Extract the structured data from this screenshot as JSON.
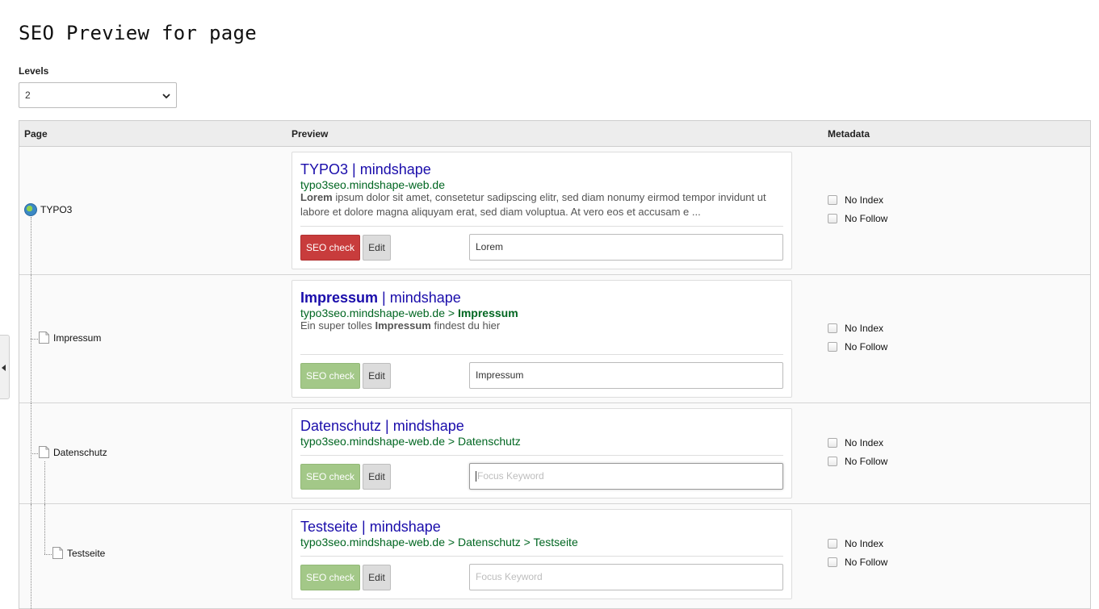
{
  "title": "SEO Preview for page",
  "levels": {
    "label": "Levels",
    "value": "2"
  },
  "table": {
    "headers": {
      "page": "Page",
      "preview": "Preview",
      "metadata": "Metadata"
    }
  },
  "buttons": {
    "seo_check": "SEO check",
    "edit": "Edit"
  },
  "metadata_labels": {
    "no_index": "No Index",
    "no_follow": "No Follow"
  },
  "keyword_placeholder": "Focus Keyword",
  "colors": {
    "seo_bad": "#c83c3c",
    "seo_good": "#a3c888",
    "serp_title": "#1a0dab",
    "serp_url": "#006621"
  },
  "rows": [
    {
      "page": "TYPO3",
      "icon": "globe-icon",
      "serp_title": "TYPO3 | mindshape",
      "serp_url": "typo3seo.mindshape-web.de",
      "desc_bold": "Lorem",
      "desc_rest": " ipsum dolor sit amet, consetetur sadipscing elitr, sed diam nonumy eirmod tempor invidunt ut labore et dolore magna aliquyam erat, sed diam voluptua. At vero eos et accusam e ...",
      "seo_status": "bad",
      "focus_keyword": "Lorem"
    },
    {
      "page": "Impressum",
      "icon": "document-icon",
      "serp_title_bold": "Impressum",
      "serp_title_rest": " | mindshape",
      "serp_url_prefix": "typo3seo.mindshape-web.de > ",
      "serp_url_bold": "Impressum",
      "desc_pre": "Ein super tolles ",
      "desc_bold": "Impressum",
      "desc_post": " findest du hier",
      "seo_status": "good",
      "focus_keyword": "Impressum"
    },
    {
      "page": "Datenschutz",
      "icon": "document-icon",
      "serp_title": "Datenschutz | mindshape",
      "serp_url": "typo3seo.mindshape-web.de > Datenschutz",
      "seo_status": "good",
      "focus_keyword": ""
    },
    {
      "page": "Testseite",
      "icon": "document-icon",
      "serp_title": "Testseite | mindshape",
      "serp_url": "typo3seo.mindshape-web.de > Datenschutz > Testseite",
      "seo_status": "good",
      "focus_keyword": ""
    }
  ]
}
